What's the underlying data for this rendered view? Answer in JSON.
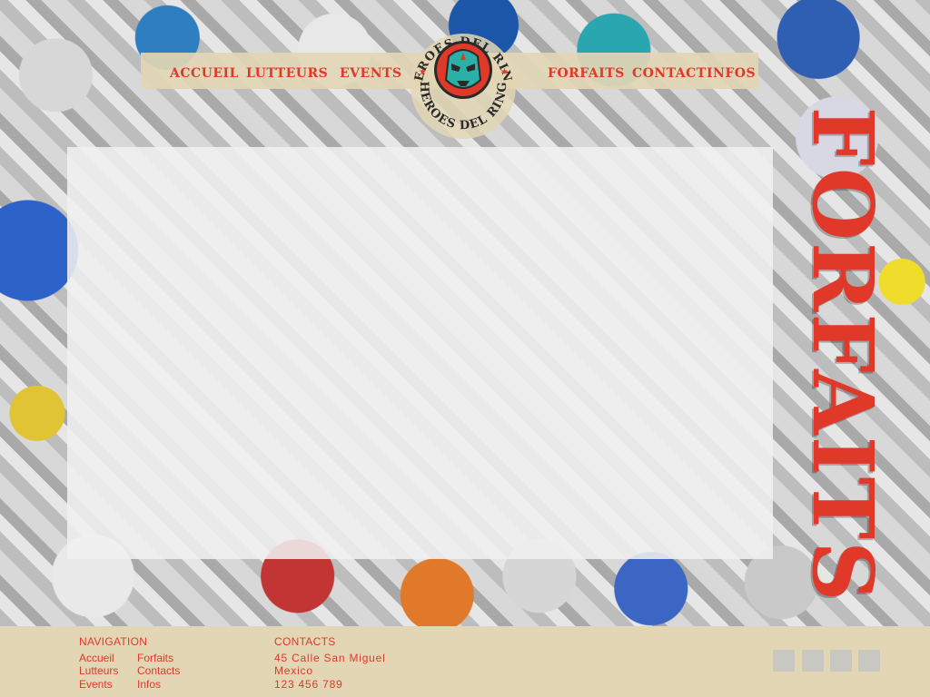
{
  "nav": {
    "left": [
      "ACCUEIL",
      "LUTTEURS",
      "EVENTS"
    ],
    "right": [
      "FORFAITS",
      "CONTACT",
      "INFOS"
    ]
  },
  "logo": {
    "top_text": "HEROES DEL RING",
    "bottom_text": "HEROES DEL RING",
    "icon": "luchador-mask-icon",
    "colors": {
      "ring": "#e0392a",
      "mask": "#2ab0a6",
      "outer": "#2a2a2a"
    }
  },
  "page": {
    "title": "FORFAITS"
  },
  "footer": {
    "navigation": {
      "heading": "NAVIGATION",
      "col1": [
        "Accueil",
        "Lutteurs",
        "Events"
      ],
      "col2": [
        "Forfaits",
        "Contacts",
        "Infos"
      ]
    },
    "contacts": {
      "heading": "CONTACTS",
      "address": "45 Calle San Miguel",
      "country": "Mexico",
      "phone": "123 456 789"
    },
    "social_icons": [
      "social-icon-1",
      "social-icon-2",
      "social-icon-3",
      "social-icon-4"
    ]
  },
  "colors": {
    "accent": "#e0392a",
    "band": "#e2d6b5"
  }
}
